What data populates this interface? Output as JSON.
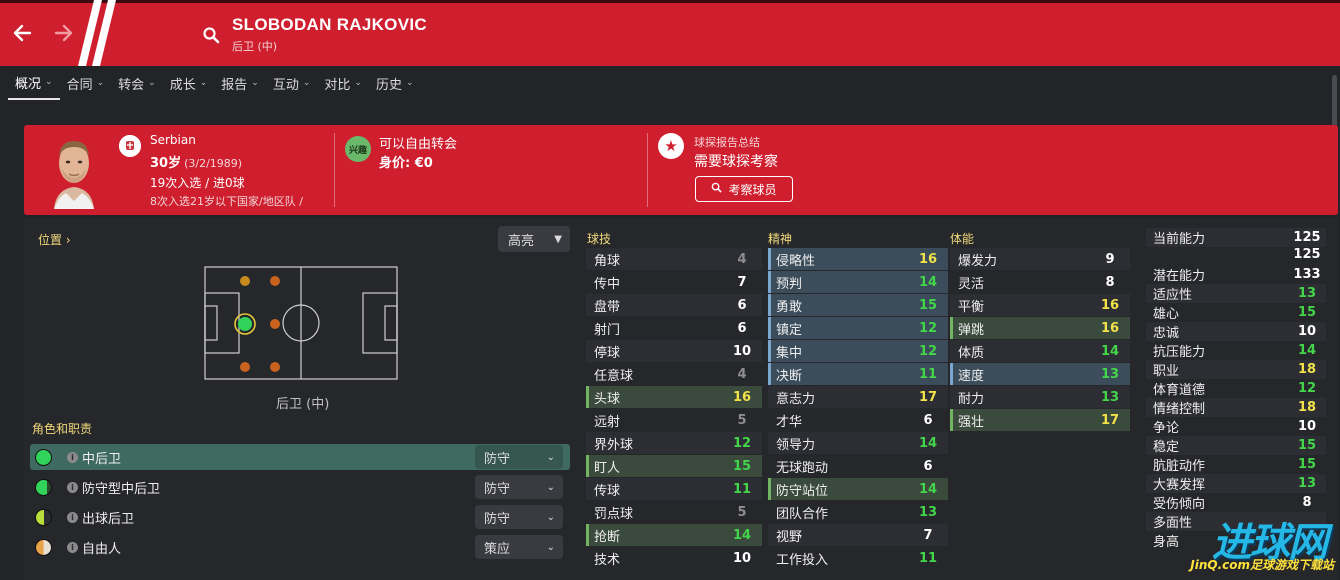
{
  "header": {
    "player_name": "SLOBODAN RAJKOVIC",
    "position": "后卫 (中)"
  },
  "tabs": [
    {
      "label": "概况",
      "active": true,
      "chevron": true
    },
    {
      "label": "合同",
      "chevron": true
    },
    {
      "label": "转会",
      "chevron": true
    },
    {
      "label": "成长",
      "chevron": true
    },
    {
      "label": "报告",
      "chevron": true
    },
    {
      "label": "互动",
      "chevron": true
    },
    {
      "label": "对比",
      "chevron": true
    },
    {
      "label": "历史",
      "chevron": true
    }
  ],
  "profile": {
    "nationality": "Serbian",
    "age": "30岁",
    "dob": "(3/2/1989)",
    "caps": "19次入选 / 进0球",
    "u21": "8次入选21岁以下国家/地区队 /",
    "interest_badge": "兴趣",
    "transfer_status": "可以自由转会",
    "value": "身价: €0",
    "scout_title": "球探报告总结",
    "scout_need": "需要球探考察",
    "scout_button": "考察球员"
  },
  "left": {
    "position_link": "位置",
    "highlight_select": "高亮",
    "pitch_caption": "后卫 (中)",
    "roles_heading": "角色和职责",
    "roles": [
      {
        "name": "中后卫",
        "duty": "防守",
        "selected": true,
        "fit": "full"
      },
      {
        "name": "防守型中后卫",
        "duty": "防守",
        "fit": "high"
      },
      {
        "name": "出球后卫",
        "duty": "防守",
        "fit": "mid"
      },
      {
        "name": "自由人",
        "duty": "策应",
        "fit": "low"
      }
    ]
  },
  "colors": {
    "red": "#cf1f2f",
    "grey_value": "#8e8e8e",
    "white_value": "#ffffff",
    "yellow_value": "#f2e24a",
    "green_value": "#43d54a"
  },
  "technical": {
    "heading": "球技",
    "items": [
      {
        "name": "角球",
        "value": "4",
        "tier": "grey"
      },
      {
        "name": "传中",
        "value": "7",
        "tier": "white"
      },
      {
        "name": "盘带",
        "value": "6",
        "tier": "white"
      },
      {
        "name": "射门",
        "value": "6",
        "tier": "white"
      },
      {
        "name": "停球",
        "value": "10",
        "tier": "white"
      },
      {
        "name": "任意球",
        "value": "4",
        "tier": "grey"
      },
      {
        "name": "头球",
        "value": "16",
        "tier": "yellow",
        "hl": "key"
      },
      {
        "name": "远射",
        "value": "5",
        "tier": "grey"
      },
      {
        "name": "界外球",
        "value": "12",
        "tier": "green"
      },
      {
        "name": "盯人",
        "value": "15",
        "tier": "green",
        "hl": "key"
      },
      {
        "name": "传球",
        "value": "11",
        "tier": "green"
      },
      {
        "name": "罚点球",
        "value": "5",
        "tier": "grey"
      },
      {
        "name": "抢断",
        "value": "14",
        "tier": "green",
        "hl": "key"
      },
      {
        "name": "技术",
        "value": "10",
        "tier": "white"
      }
    ]
  },
  "mental": {
    "heading": "精神",
    "items": [
      {
        "name": "侵略性",
        "value": "16",
        "tier": "yellow",
        "hl": "pri"
      },
      {
        "name": "预判",
        "value": "14",
        "tier": "green",
        "hl": "pri"
      },
      {
        "name": "勇敢",
        "value": "15",
        "tier": "green",
        "hl": "pri"
      },
      {
        "name": "镇定",
        "value": "12",
        "tier": "green",
        "hl": "pri"
      },
      {
        "name": "集中",
        "value": "12",
        "tier": "green",
        "hl": "pri"
      },
      {
        "name": "决断",
        "value": "11",
        "tier": "green",
        "hl": "pri"
      },
      {
        "name": "意志力",
        "value": "17",
        "tier": "yellow"
      },
      {
        "name": "才华",
        "value": "6",
        "tier": "white"
      },
      {
        "name": "领导力",
        "value": "14",
        "tier": "green"
      },
      {
        "name": "无球跑动",
        "value": "6",
        "tier": "white"
      },
      {
        "name": "防守站位",
        "value": "14",
        "tier": "green",
        "hl": "key"
      },
      {
        "name": "团队合作",
        "value": "13",
        "tier": "green"
      },
      {
        "name": "视野",
        "value": "7",
        "tier": "white"
      },
      {
        "name": "工作投入",
        "value": "11",
        "tier": "green"
      }
    ]
  },
  "physical": {
    "heading": "体能",
    "items": [
      {
        "name": "爆发力",
        "value": "9",
        "tier": "white"
      },
      {
        "name": "灵活",
        "value": "8",
        "tier": "white"
      },
      {
        "name": "平衡",
        "value": "16",
        "tier": "yellow"
      },
      {
        "name": "弹跳",
        "value": "16",
        "tier": "yellow",
        "hl": "key"
      },
      {
        "name": "体质",
        "value": "14",
        "tier": "green"
      },
      {
        "name": "速度",
        "value": "13",
        "tier": "green",
        "hl": "pri"
      },
      {
        "name": "耐力",
        "value": "13",
        "tier": "green"
      },
      {
        "name": "强壮",
        "value": "17",
        "tier": "yellow",
        "hl": "key"
      }
    ]
  },
  "hidden": {
    "ability_current": "125",
    "ability_current_2": "125",
    "items": [
      {
        "name": "当前能力",
        "value": "125",
        "tier": "white"
      },
      {
        "name": "潜在能力",
        "value": "133",
        "tier": "white"
      },
      {
        "name": "适应性",
        "value": "13",
        "tier": "green"
      },
      {
        "name": "雄心",
        "value": "15",
        "tier": "green"
      },
      {
        "name": "忠诚",
        "value": "10",
        "tier": "white"
      },
      {
        "name": "抗压能力",
        "value": "14",
        "tier": "green"
      },
      {
        "name": "职业",
        "value": "18",
        "tier": "yellow"
      },
      {
        "name": "体育道德",
        "value": "12",
        "tier": "green"
      },
      {
        "name": "情绪控制",
        "value": "18",
        "tier": "yellow"
      },
      {
        "name": "争论",
        "value": "10",
        "tier": "white"
      },
      {
        "name": "稳定",
        "value": "15",
        "tier": "green"
      },
      {
        "name": "肮脏动作",
        "value": "15",
        "tier": "green"
      },
      {
        "name": "大赛发挥",
        "value": "13",
        "tier": "green"
      },
      {
        "name": "受伤倾向",
        "value": "8",
        "tier": "white"
      },
      {
        "name": "多面性",
        "value": "",
        "tier": "white"
      },
      {
        "name": "身高",
        "value": "",
        "tier": "white"
      }
    ]
  },
  "watermark": {
    "big": "进球网",
    "small": "JinQ.com足球游戏下载站"
  }
}
